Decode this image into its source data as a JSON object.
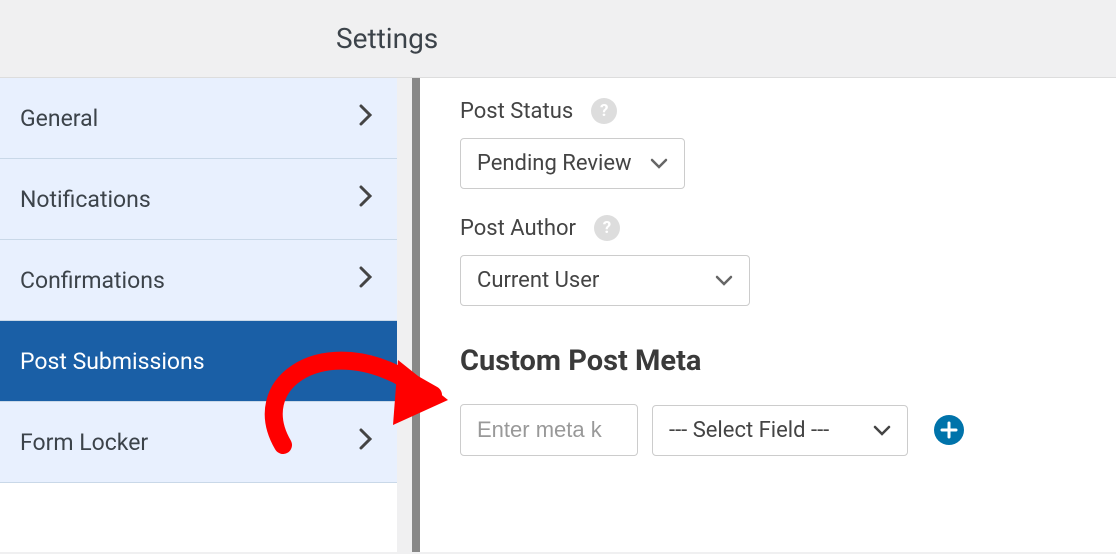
{
  "header": {
    "title": "Settings"
  },
  "sidebar": {
    "items": [
      {
        "label": "General",
        "active": false
      },
      {
        "label": "Notifications",
        "active": false
      },
      {
        "label": "Confirmations",
        "active": false
      },
      {
        "label": "Post Submissions",
        "active": true
      },
      {
        "label": "Form Locker",
        "active": false
      }
    ]
  },
  "content": {
    "post_status": {
      "label": "Post Status",
      "value": "Pending Review"
    },
    "post_author": {
      "label": "Post Author",
      "value": "Current User"
    },
    "custom_meta": {
      "title": "Custom Post Meta",
      "key_placeholder": "Enter meta k",
      "field_placeholder": "--- Select Field ---"
    }
  }
}
